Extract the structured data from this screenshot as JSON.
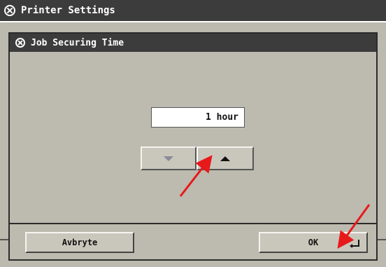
{
  "window": {
    "title": "Printer Settings",
    "icon": "settings-glyph-icon"
  },
  "dialog": {
    "title": "Job Securing Time",
    "value": "1 hour"
  },
  "buttons": {
    "cancel_label": "Avbryte",
    "ok_label": "OK"
  },
  "annotation_color": "#e8191b"
}
